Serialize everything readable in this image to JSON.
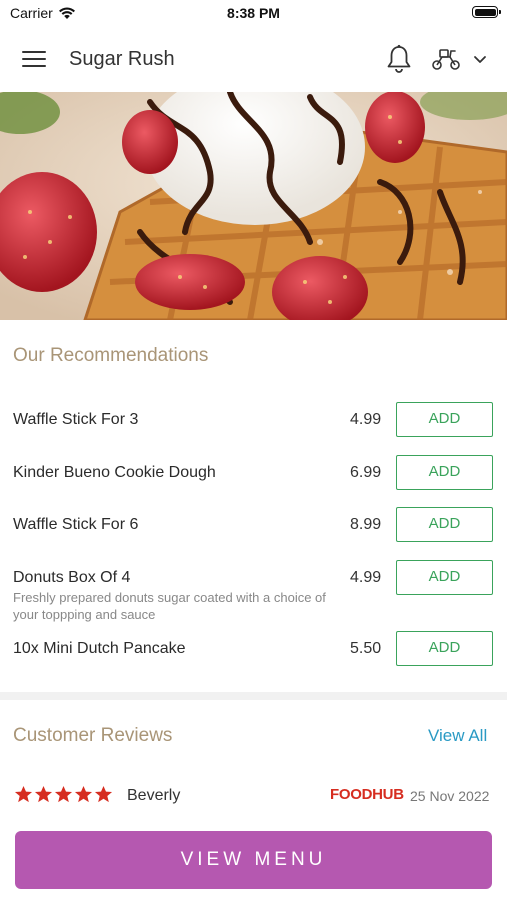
{
  "status_bar": {
    "carrier": "Carrier",
    "time": "8:38 PM"
  },
  "header": {
    "title": "Sugar Rush"
  },
  "hero": {
    "image_alt": "Waffle with ice cream, chocolate sauce and strawberries"
  },
  "recommendations": {
    "title": "Our Recommendations",
    "items": [
      {
        "name": "Waffle Stick For 3",
        "description": "",
        "price": "4.99",
        "button": "ADD"
      },
      {
        "name": "Kinder Bueno Cookie Dough",
        "description": "",
        "price": "6.99",
        "button": "ADD"
      },
      {
        "name": "Waffle Stick For 6",
        "description": "",
        "price": "8.99",
        "button": "ADD"
      },
      {
        "name": "Donuts Box Of 4",
        "description": "Freshly prepared donuts sugar coated with a choice of your toppping and sauce",
        "price": "4.99",
        "button": "ADD"
      },
      {
        "name": "10x Mini Dutch Pancake",
        "description": "",
        "price": "5.50",
        "button": "ADD"
      }
    ]
  },
  "reviews": {
    "title": "Customer Reviews",
    "view_all": "View All",
    "items": [
      {
        "rating": 5,
        "name": "Beverly",
        "source": "FOODHUB",
        "date": "25 Nov 2022"
      }
    ]
  },
  "footer": {
    "view_menu": "VIEW MENU"
  },
  "colors": {
    "accent": "#b558b0",
    "add_green": "#3aa35b",
    "section_title": "#a99577",
    "link": "#2a9ac4",
    "star": "#d62d20"
  }
}
